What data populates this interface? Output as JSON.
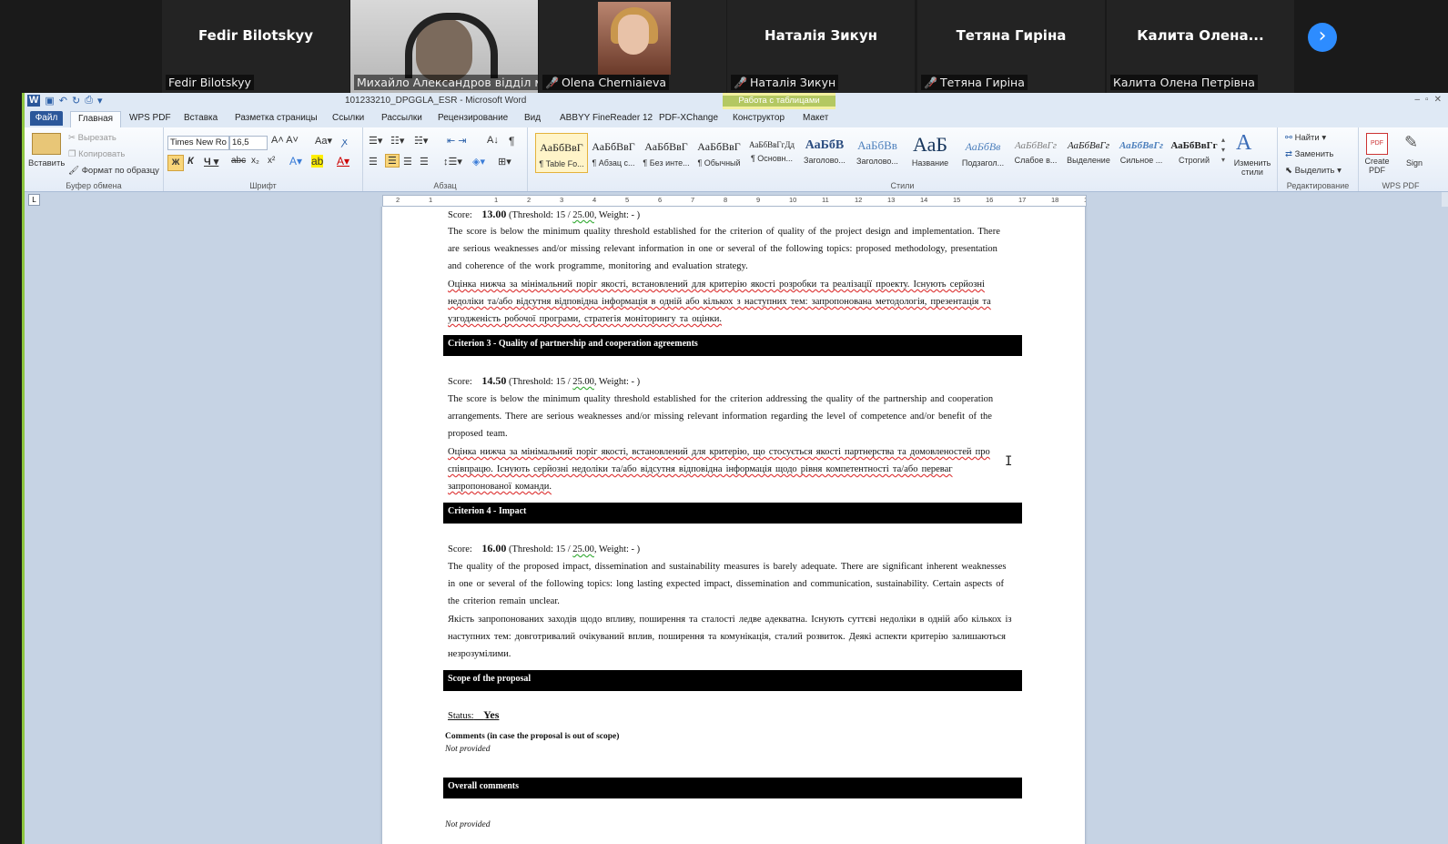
{
  "participants": [
    {
      "big_name": "Fedir Bilotskyy",
      "tag": "Fedir Bilotskyy",
      "muted": false,
      "video": false
    },
    {
      "big_name": "",
      "tag": "Михайло Александров відділ мі...",
      "muted": false,
      "video": true,
      "active": true
    },
    {
      "big_name": "",
      "tag": "Olena Cherniaieva",
      "muted": true,
      "video": true
    },
    {
      "big_name": "Наталія Зикун",
      "tag": "Наталія Зикун",
      "muted": true,
      "video": false
    },
    {
      "big_name": "Тетяна Гиріна",
      "tag": "Тетяна Гиріна",
      "muted": true,
      "video": false
    },
    {
      "big_name": "Калита  Олена...",
      "tag": "Калита Олена Петрівна",
      "muted": false,
      "video": false
    }
  ],
  "word": {
    "title": "101233210_DPGGLA_ESR  -  Microsoft Word",
    "context_tab": "Работа с таблицами",
    "tabs": [
      "Файл",
      "Главная",
      "WPS PDF",
      "Вставка",
      "Разметка страницы",
      "Ссылки",
      "Рассылки",
      "Рецензирование",
      "Вид",
      "ABBYY FineReader 12",
      "PDF-XChange",
      "Конструктор",
      "Макет"
    ],
    "ribbon": {
      "clipboard": {
        "paste": "Вставить",
        "cut": "Вырезать",
        "copy": "Копировать",
        "format_painter": "Формат по образцу",
        "label": "Буфер обмена"
      },
      "font": {
        "name": "Times New Ro",
        "size": "16,5",
        "label": "Шрифт"
      },
      "paragraph": {
        "label": "Абзац"
      },
      "styles": {
        "label": "Стили",
        "items": [
          {
            "sample": "АаБбВвГ",
            "name": "¶ Table Fo..."
          },
          {
            "sample": "АаБбВвГ",
            "name": "¶ Абзац с..."
          },
          {
            "sample": "АаБбВвГ",
            "name": "¶ Без инте..."
          },
          {
            "sample": "АаБбВвГ",
            "name": "¶ Обычный"
          },
          {
            "sample": "АаБбВвГгДд",
            "name": "¶ Основн..."
          },
          {
            "sample": "АаБбВ",
            "name": "Заголово..."
          },
          {
            "sample": "АаБбВв",
            "name": "Заголово..."
          },
          {
            "sample": "АаБ",
            "name": "Название"
          },
          {
            "sample": "АаБбВв",
            "name": "Подзагол..."
          },
          {
            "sample": "АаБбВвГг",
            "name": "Слабое в..."
          },
          {
            "sample": "АаБбВвГг",
            "name": "Выделение"
          },
          {
            "sample": "АаБбВвГг",
            "name": "Сильное ..."
          },
          {
            "sample": "АаБбВвГг",
            "name": "Строгий"
          }
        ],
        "change_styles": "Изменить стили"
      },
      "editing": {
        "find": "Найти",
        "replace": "Заменить",
        "select": "Выделить",
        "label": "Редактирование"
      },
      "wps": {
        "create_pdf": "Create PDF",
        "sign": "Sign",
        "label": "WPS PDF"
      }
    }
  },
  "document": {
    "c2_score": {
      "prefix": "Score:",
      "value": "13.00",
      "thr_pre": "(Threshold:  15 /",
      "max": "25.00",
      "thr_post": ", Weight:  - )"
    },
    "c2_en": "The score is below the minimum  quality  threshold  established  for the criterion  of quality  of the project design  and implementation.  There are serious weaknesses and/or missing  relevant information  in one or several of the following topics: proposed methodology,  presentation  and coherence of the work programme,  monitoring  and evaluation  strategy.",
    "c2_ua": "Оцінка нижча за мінімальний поріг якості, встановлений для критерію якості розробки та реалізації проекту. Існують серйозні недоліки та/або відсутня відповідна інформація в одній або кількох з наступних тем: запропонована методологія, презентація та узгодженість робочої програми, стратегія моніторингу та оцінки.",
    "c3_header": "Criterion 3 - Quality of partnership and cooperation  agreements",
    "c3_score": {
      "prefix": "Score:",
      "value": "14.50",
      "thr_pre": "(Threshold:  15 /",
      "max": "25.00",
      "thr_post": ", Weight:  - )"
    },
    "c3_en": "The score is below the minimum  quality  threshold  established  for the criterion  addressing the quality  of the partnership  and cooperation  arrangements.  There are serious weaknesses and/or missing  relevant information  regarding the level of competence and/or benefit  of the proposed  team.",
    "c3_ua": "Оцінка нижча за мінімальний поріг якості, встановлений для критерію, що стосується якості партнерства та домовленостей про співпрацю. Існують серйозні недоліки та/або відсутня відповідна інформація щодо рівня компетентності та/або переваг запропонованої команди.",
    "c4_header": "Criterion 4 - Impact",
    "c4_score": {
      "prefix": "Score:",
      "value": "16.00",
      "thr_pre": "(Threshold:  15 /",
      "max": "25.00",
      "thr_post": ", Weight:  - )"
    },
    "c4_en": "The quality  of the proposed  impact,  dissemination  and sustainability  measures is barely  adequate. There are significant inherent  weaknesses in one or several of the following  topics: long  lasting  expected impact,  dissemination  and communication,  sustainability.  Certain aspects of the criterion  remain unclear.",
    "c4_ua": "Якість запропонованих заходів щодо впливу, поширення та сталості ледве адекватна. Існують суттєві недоліки в одній або кількох із наступних тем: довготривалий очікуваний вплив, поширення та комунікація, сталий розвиток. Деякі аспекти критерію залишаються незрозумілими.",
    "scope_header": "Scope of the proposal",
    "status_label": "Status:",
    "status_value": "Yes",
    "comments_label": "Comments (in case the proposal  is out of scope)",
    "comments_value": "Not provided",
    "overall_header": "Overall comments",
    "overall_value": "Not provided"
  }
}
